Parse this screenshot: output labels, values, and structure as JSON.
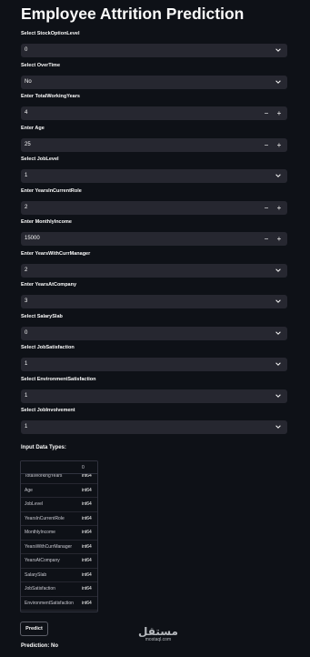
{
  "title": "Employee Attrition Prediction",
  "fields": [
    {
      "label": "Select StockOptionLevel",
      "type": "select",
      "value": "0"
    },
    {
      "label": "Select OverTime",
      "type": "select",
      "value": "No"
    },
    {
      "label": "Enter TotalWorkingYears",
      "type": "number",
      "value": "4"
    },
    {
      "label": "Enter Age",
      "type": "number",
      "value": "25"
    },
    {
      "label": "Select JobLevel",
      "type": "select",
      "value": "1"
    },
    {
      "label": "Enter YearsInCurrentRole",
      "type": "number",
      "value": "2"
    },
    {
      "label": "Enter MonthlyIncome",
      "type": "number",
      "value": "15000"
    },
    {
      "label": "Enter YearsWithCurrManager",
      "type": "select",
      "value": "2"
    },
    {
      "label": "Enter YearsAtCompany",
      "type": "select",
      "value": "3"
    },
    {
      "label": "Select SalarySlab",
      "type": "select",
      "value": "0"
    },
    {
      "label": "Select JobSatisfaction",
      "type": "select",
      "value": "1"
    },
    {
      "label": "Select EnvironmentSatisfaction",
      "type": "select",
      "value": "1"
    },
    {
      "label": "Select JobInvolvement",
      "type": "select",
      "value": "1"
    }
  ],
  "dtypes": {
    "heading": "Input Data Types:",
    "column_header": "0",
    "rows": [
      {
        "name": "TotalWorkingYears",
        "type": "int64"
      },
      {
        "name": "Age",
        "type": "int64"
      },
      {
        "name": "JobLevel",
        "type": "int64"
      },
      {
        "name": "YearsInCurrentRole",
        "type": "int64"
      },
      {
        "name": "MonthlyIncome",
        "type": "int64"
      },
      {
        "name": "YearsWithCurrManager",
        "type": "int64"
      },
      {
        "name": "YearsAtCompany",
        "type": "int64"
      },
      {
        "name": "SalarySlab",
        "type": "int64"
      },
      {
        "name": "JobSatisfaction",
        "type": "int64"
      },
      {
        "name": "EnvironmentSatisfaction",
        "type": "int64"
      },
      {
        "name": "JobInvolvement",
        "type": "int64"
      }
    ]
  },
  "predict_button": "Predict",
  "prediction": "Prediction: No",
  "watermark": {
    "arabic": "مستقل",
    "latin": "mostaql.com"
  },
  "colors": {
    "background": "#0e1117",
    "input_bg": "#262730",
    "text": "#fafafa"
  }
}
